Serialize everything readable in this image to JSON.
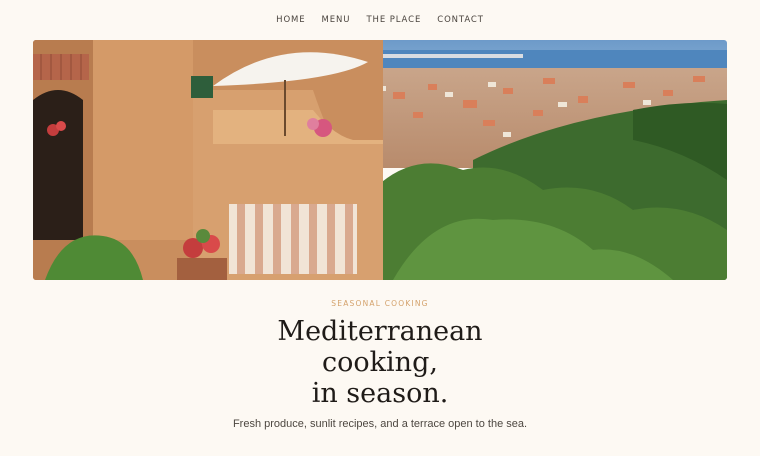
{
  "nav": {
    "items": [
      {
        "label": "HOME"
      },
      {
        "label": "MENU"
      },
      {
        "label": "THE PLACE"
      },
      {
        "label": "CONTACT"
      }
    ]
  },
  "hero": {
    "eyebrow": "SEASONAL COOKING",
    "headline_lines": [
      "Mediterranean",
      "cooking,",
      "in season."
    ],
    "subtitle": "Fresh produce, sunlit recipes, and a terrace open to the sea."
  },
  "colors": {
    "background": "#fdf9f3",
    "accent": "#d4a26c",
    "text": "#1f1b18"
  }
}
